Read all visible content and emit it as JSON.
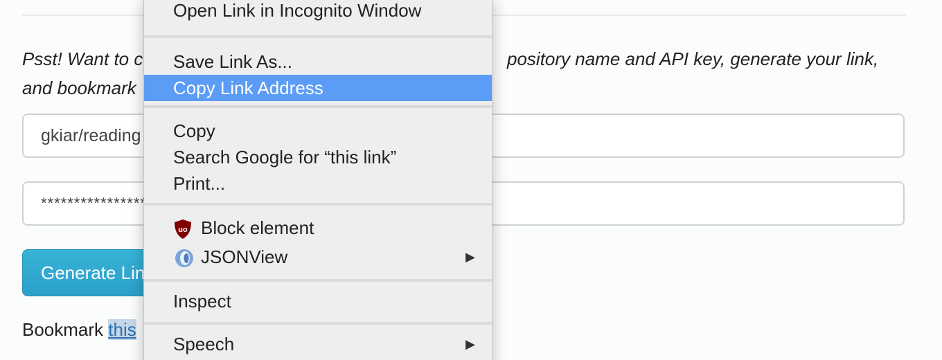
{
  "page": {
    "psst_left": "Psst! Want to c",
    "psst_right": "pository name and API key, generate your link,",
    "psst_line2": "and bookmark",
    "repo_input_value": "gkiar/reading",
    "key_input_value": "****************",
    "generate_button_label": "Generate Lin",
    "bookmark_prefix": "Bookmark ",
    "bookmark_link": "this"
  },
  "context_menu": {
    "items": [
      {
        "label": "Open Link in Incognito Window"
      },
      {
        "label": "Save Link As..."
      },
      {
        "label": "Copy Link Address",
        "selected": true
      },
      {
        "label": "Copy"
      },
      {
        "label": "Search Google for “this link”"
      },
      {
        "label": "Print..."
      },
      {
        "label": "Block element",
        "icon": "ublock-origin-icon"
      },
      {
        "label": "JSONView",
        "icon": "jsonview-icon",
        "submenu": true
      },
      {
        "label": "Inspect"
      },
      {
        "label": "Speech",
        "submenu": true
      }
    ],
    "submenu_arrow": "▶",
    "ublock_glyph": "uo",
    "highlight_color": "#5b9cf6"
  }
}
